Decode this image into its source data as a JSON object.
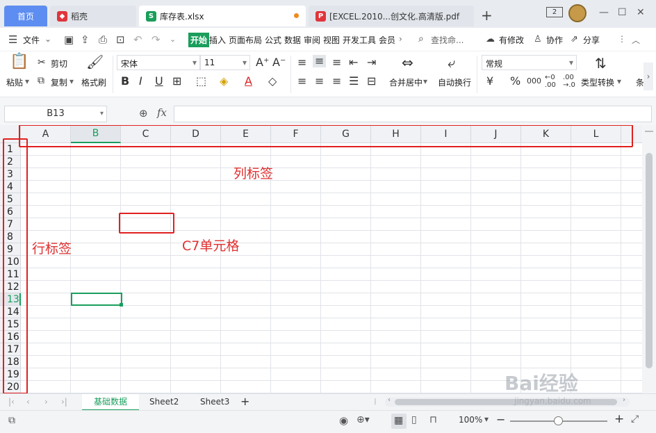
{
  "tabs": {
    "home": "首页",
    "t1": "稻壳",
    "t2": "库存表.xlsx",
    "t3": "[EXCEL.2010...创文化.高清版.pdf",
    "new": "+"
  },
  "window": {
    "badge": "2"
  },
  "menu": {
    "file": "文件",
    "start": "开始",
    "insert": "插入",
    "layout": "页面布局",
    "formula": "公式",
    "data": "数据",
    "review": "审阅",
    "view": "视图",
    "dev": "开发工具",
    "member": "会员",
    "search": "查找命...",
    "changes": "有修改",
    "collab": "协作",
    "share": "分享"
  },
  "ribbon": {
    "paste": "粘贴",
    "cut": "剪切",
    "copy": "复制",
    "format_painter": "格式刷",
    "font_name": "宋体",
    "font_size": "11",
    "merge_center": "合并居中",
    "wrap": "自动换行",
    "number_format": "常规",
    "type_convert": "类型转换",
    "more": "条"
  },
  "formula_bar": {
    "name_box": "B13",
    "fx": "fx",
    "value": ""
  },
  "grid": {
    "columns": [
      "A",
      "B",
      "C",
      "D",
      "E",
      "F",
      "G",
      "H",
      "I",
      "J",
      "K",
      "L"
    ],
    "rows": [
      "1",
      "2",
      "3",
      "4",
      "5",
      "6",
      "7",
      "8",
      "9",
      "10",
      "11",
      "12",
      "13",
      "14",
      "15",
      "16",
      "17",
      "18",
      "19",
      "20"
    ],
    "active_cell": "B13",
    "active_col": "B",
    "active_row": "13"
  },
  "annotations": {
    "col_label": "列标签",
    "row_label": "行标签",
    "cell_label": "C7单元格"
  },
  "sheets": [
    "基础数据",
    "Sheet2",
    "Sheet3"
  ],
  "active_sheet": "基础数据",
  "status": {
    "zoom": "100%"
  },
  "watermark": {
    "brand": "Bai经验",
    "url": "jingyan.baidu.com"
  },
  "colors": {
    "accent_green": "#1a9e5c",
    "annotation_red": "#e02020",
    "home_tab": "#5d8df0"
  }
}
